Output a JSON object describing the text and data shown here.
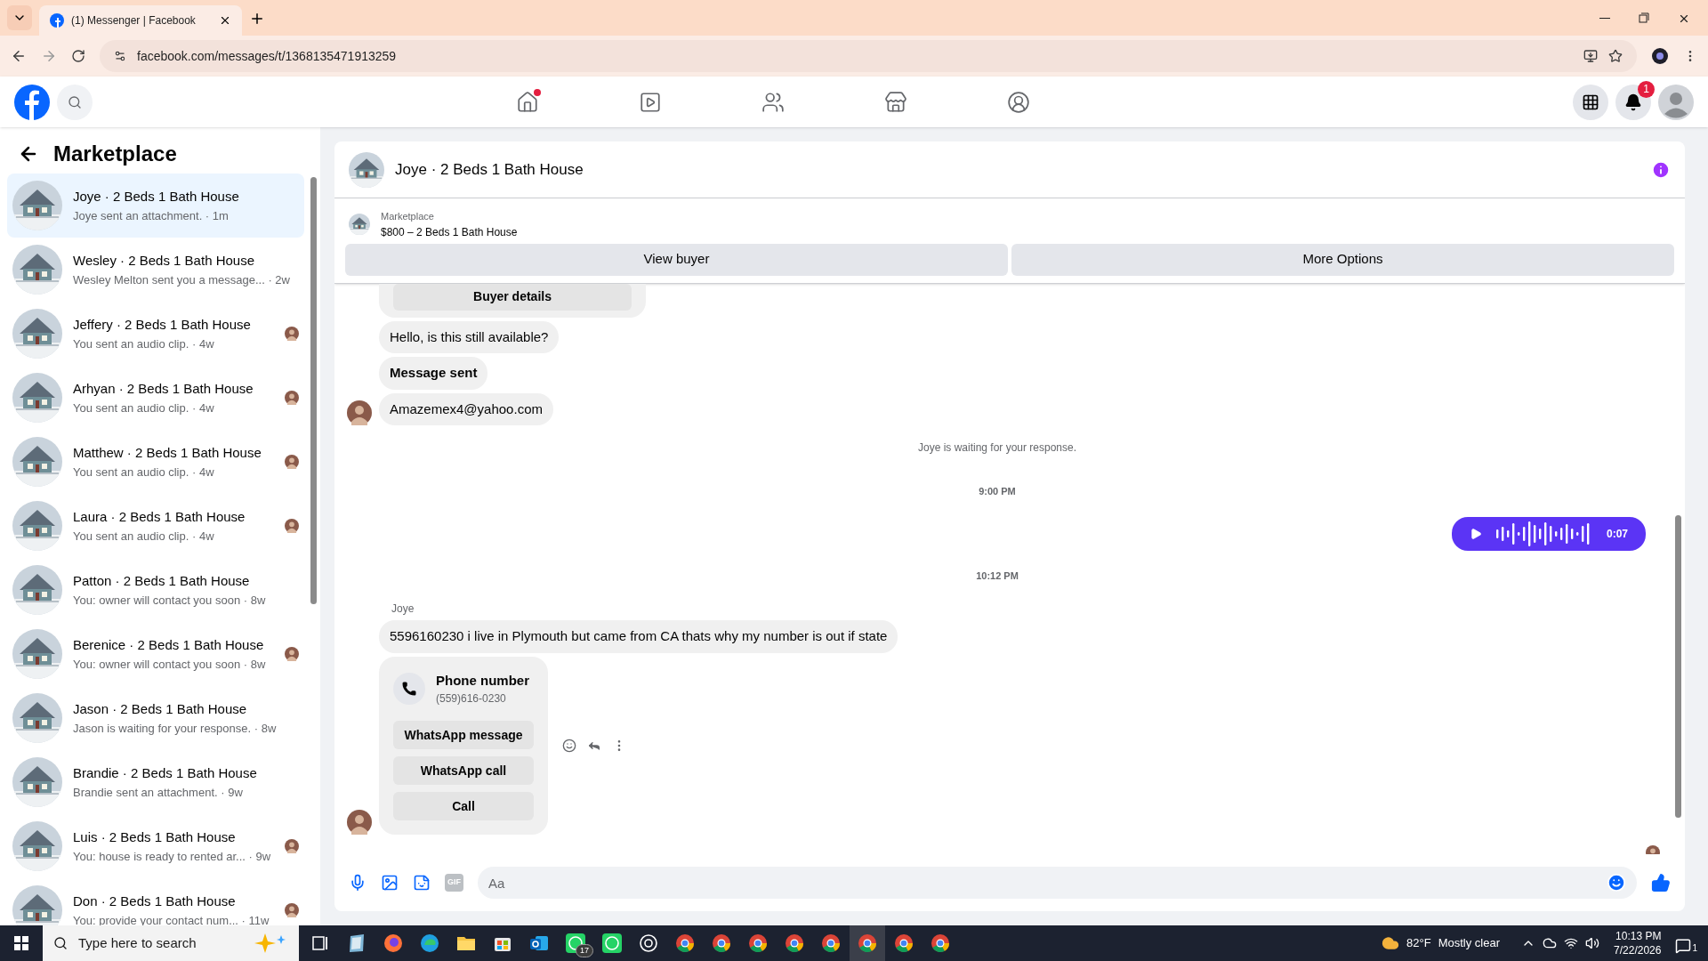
{
  "browser": {
    "tab_title": "(1) Messenger | Facebook",
    "address": "facebook.com/messages/t/1368135471913259"
  },
  "nav": {
    "items": [
      {
        "kind": "home",
        "dot": true
      },
      {
        "kind": "video",
        "dot": false
      },
      {
        "kind": "friends",
        "dot": false
      },
      {
        "kind": "marketplace",
        "dot": false
      },
      {
        "kind": "groups",
        "dot": false
      }
    ],
    "notification_count": "1"
  },
  "sidebar": {
    "title": "Marketplace",
    "conversations": [
      {
        "title": "Joye · 2 Beds 1 Bath House",
        "preview": "Joye sent an attachment. · 1m",
        "selected": true,
        "seen": false
      },
      {
        "title": "Wesley · 2 Beds 1 Bath House",
        "preview": "Wesley Melton sent you a message... · 2w",
        "selected": false,
        "seen": false
      },
      {
        "title": "Jeffery · 2 Beds 1 Bath House",
        "preview": "You sent an audio clip. · 4w",
        "selected": false,
        "seen": true
      },
      {
        "title": "Arhyan · 2 Beds 1 Bath House",
        "preview": "You sent an audio clip. · 4w",
        "selected": false,
        "seen": true
      },
      {
        "title": "Matthew · 2 Beds 1 Bath House",
        "preview": "You sent an audio clip. · 4w",
        "selected": false,
        "seen": true
      },
      {
        "title": "Laura · 2 Beds 1 Bath House",
        "preview": "You sent an audio clip. · 4w",
        "selected": false,
        "seen": true
      },
      {
        "title": "Patton · 2 Beds 1 Bath House",
        "preview": "You: owner will contact you soon · 8w",
        "selected": false,
        "seen": false
      },
      {
        "title": "Berenice · 2 Beds 1 Bath House",
        "preview": "You: owner will contact you soon · 8w",
        "selected": false,
        "seen": true
      },
      {
        "title": "Jason · 2 Beds 1 Bath House",
        "preview": "Jason is waiting for your response. · 8w",
        "selected": false,
        "seen": false
      },
      {
        "title": "Brandie · 2 Beds 1 Bath House",
        "preview": "Brandie sent an attachment. · 9w",
        "selected": false,
        "seen": false
      },
      {
        "title": "Luis · 2 Beds 1 Bath House",
        "preview": "You: house is ready to rented ar...  · 9w",
        "selected": false,
        "seen": true
      },
      {
        "title": "Don · 2 Beds 1 Bath House",
        "preview": "You: provide your contact num...  · 11w",
        "selected": false,
        "seen": true
      }
    ]
  },
  "chat": {
    "title": "Joye · 2 Beds 1 Bath House",
    "listing": {
      "label": "Marketplace",
      "title": "$800 – 2 Beds 1 Bath House"
    },
    "buttons": [
      "View buyer",
      "More Options"
    ],
    "messages": [
      {
        "kind": "card_button",
        "text": "Buyer details"
      },
      {
        "kind": "text",
        "text": "Hello, is this still available?"
      },
      {
        "kind": "notice",
        "text": "Message sent"
      },
      {
        "kind": "text",
        "text": "Amazemex4@yahoo.com",
        "avatar": true
      },
      {
        "kind": "system",
        "text": "Joye is waiting for your response."
      },
      {
        "kind": "time",
        "text": "9:00 PM"
      },
      {
        "kind": "audio",
        "text": "0:07"
      },
      {
        "kind": "time",
        "text": "10:12 PM"
      },
      {
        "kind": "sender",
        "text": "Joye"
      },
      {
        "kind": "text",
        "text": "5596160230 i live in Plymouth but came from CA thats why my number is out if state"
      },
      {
        "kind": "contact",
        "text": "Phone number",
        "number": "(559)616-0230",
        "actions": [
          "WhatsApp message",
          "WhatsApp call",
          "Call"
        ],
        "avatar": true
      }
    ],
    "composer": {
      "placeholder": "Aa",
      "gif_label": "GIF"
    }
  },
  "taskbar": {
    "search_placeholder": "Type here to search",
    "apps": [
      {
        "kind": "task-view",
        "selected": false
      },
      {
        "kind": "notes",
        "selected": false
      },
      {
        "kind": "firefox",
        "selected": false
      },
      {
        "kind": "edge",
        "selected": false
      },
      {
        "kind": "folder",
        "selected": false
      },
      {
        "kind": "store",
        "selected": false
      },
      {
        "kind": "outlook",
        "selected": false
      },
      {
        "kind": "whatsapp",
        "selected": false,
        "badge": "17"
      },
      {
        "kind": "whatsapp",
        "selected": false
      },
      {
        "kind": "chatgpt",
        "selected": false
      },
      {
        "kind": "chrome",
        "selected": false
      },
      {
        "kind": "chrome",
        "selected": false
      },
      {
        "kind": "chrome",
        "selected": false
      },
      {
        "kind": "chrome",
        "selected": false
      },
      {
        "kind": "chrome",
        "selected": false
      },
      {
        "kind": "chrome",
        "selected": true
      },
      {
        "kind": "chrome",
        "selected": false
      },
      {
        "kind": "chrome",
        "selected": false
      }
    ],
    "temperature": "82°F",
    "weather": "Mostly clear",
    "time": "10:13 PM",
    "date": "7/22/2026",
    "notifications": "1"
  }
}
